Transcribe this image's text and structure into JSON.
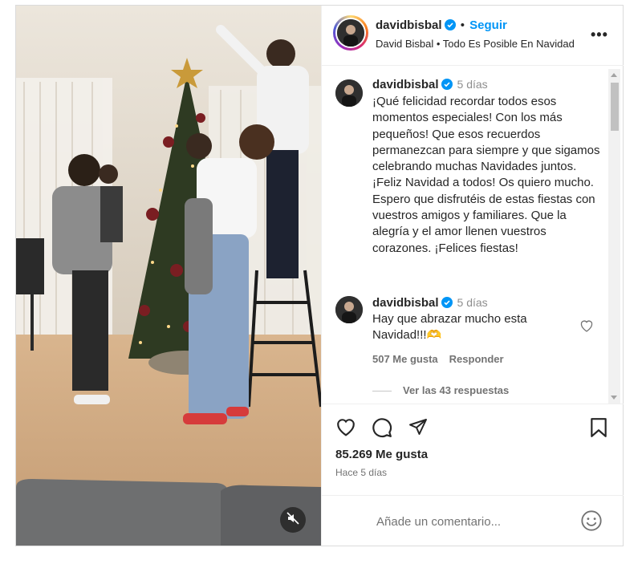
{
  "post": {
    "username": "davidbisbal",
    "follow_label": "Seguir",
    "separator": "•",
    "subtitle": "David Bisbal • Todo Es Posible En Navidad",
    "more_label": "•••"
  },
  "caption": {
    "username": "davidbisbal",
    "time": "5 días",
    "text": "¡Qué felicidad recordar todos esos momentos especiales! Con los más pequeños! Que esos recuerdos permanezcan para siempre y que sigamos celebrando muchas Navidades juntos. ¡Feliz Navidad a todos! Os quiero mucho. Espero que disfrutéis de estas fiestas con vuestros amigos y familiares. Que la alegría y el amor llenen vuestros corazones. ¡Felices fiestas!"
  },
  "comment": {
    "username": "davidbisbal",
    "time": "5 días",
    "text": "Hay que abrazar mucho esta Navidad!!!🫶",
    "likes": "507 Me gusta",
    "reply_label": "Responder",
    "view_replies": "Ver las 43 respuestas"
  },
  "stats": {
    "likes": "85.269 Me gusta",
    "ago": "Hace 5 días"
  },
  "composer": {
    "placeholder": "Añade un comentario..."
  },
  "icons": {
    "verified": "verified-badge-icon",
    "mute": "speaker-muted-icon",
    "like": "heart-icon",
    "comment": "comment-bubble-icon",
    "share": "paper-plane-icon",
    "save": "bookmark-icon",
    "emoji": "smiley-icon"
  },
  "colors": {
    "accent": "#0095f6",
    "text": "#262626",
    "secondary": "#737373",
    "verified": "#0095f6"
  }
}
